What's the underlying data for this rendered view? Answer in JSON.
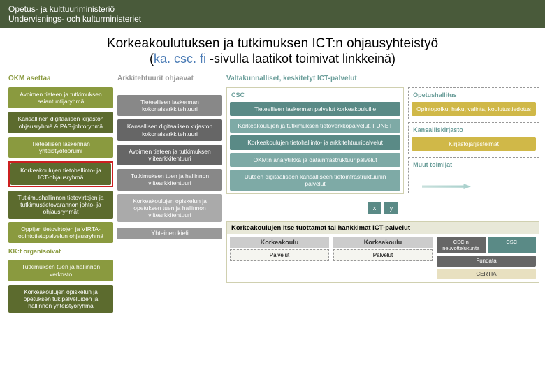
{
  "header": {
    "line1": "Opetus- ja kulttuuriministeriö",
    "line2": "Undervisnings- och kulturministeriet"
  },
  "title": {
    "main": "Korkeakoulutuksen ja tutkimuksen ICT:n ohjausyhteistyö",
    "sub_pre": "(",
    "link": "ka. csc. fi",
    "sub_post": " -sivulla laatikot toimivat linkkeinä)"
  },
  "col1": {
    "head": "OKM asettaa",
    "b1": "Avoimen tieteen ja tutkimuksen asiantuntijaryhmä",
    "b2": "Kansallinen digitaalisen kirjaston ohjausryhmä & PAS-johtoryhmä",
    "b3": "Tieteellisen laskennan yhteistyöfoorumi",
    "b4": "Korkeakoulujen tietohallinto- ja ICT-ohjausryhmä",
    "b5": "Tutkimushallinnon tietovirtojen ja tutkimustietovarannon johto- ja ohjausryhmät",
    "b6": "Oppijan tietovirtojen ja VIRTA-opintotietopalvelun ohjausryhmä",
    "sect2": "KK:t organisoivat",
    "b7": "Tutkimuksen tuen ja hallinnon verkosto",
    "b8": "Korkeakoulujen opiskelun ja opetuksen tukipalveluiden ja hallinnon yhteistyöryhmä"
  },
  "col2": {
    "head": "Arkkitehtuurit ohjaavat",
    "b1": "Tieteellisen laskennan kokonaisarkkitehtuuri",
    "b2": "Kansallisen digitaalisen kirjaston kokonaisarkkitehtuuri",
    "b3": "Avoimen tieteen ja tutkimuksen viitearkkitehtuuri",
    "b4": "Tutkimuksen tuen ja hallinnon viitearkkitehtuuri",
    "b5": "Korkeakoulujen opiskelun ja opetuksen tuen ja hallinnon viitearkkitehtuuri",
    "yk": "Yhteinen kieli"
  },
  "col3": {
    "head": "Valtakunnalliset, keskitetyt ICT-palvelut",
    "csc_head": "CSC",
    "csc1": "Tieteellisen laskennan palvelut korkeakouluille",
    "csc2": "Korkeakoulujen ja tutkimuksen tietoverkkopalvelut, FUNET",
    "csc3": "Korkeakoulujen tietohallinto- ja arkkitehtuuripalvelut",
    "csc4": "OKM:n analytiikka ja datainfrastruktuuripalvelut",
    "csc5": "Uuteen digitaaliseen kansalliseen tietoinfrastruktuuriin palvelut",
    "op_head": "Opetushallitus",
    "op1": "Opintopolku, haku, valinta, koulutustiedotus",
    "kk_head": "Kansalliskirjasto",
    "kk1": "Kirjastojärjestelmät",
    "muut": "Muut toimijat",
    "x": "x",
    "y": "y",
    "rb_head": "Korkeakoulujen itse tuottamat tai hankkimat ICT-palvelut",
    "kor": "Korkeakoulu",
    "pal": "Palvelut",
    "csc_neu": "CSC:n neuvottelukunta",
    "csc_lbl": "CSC",
    "fun": "Fundata",
    "cer": "CERTIA"
  }
}
